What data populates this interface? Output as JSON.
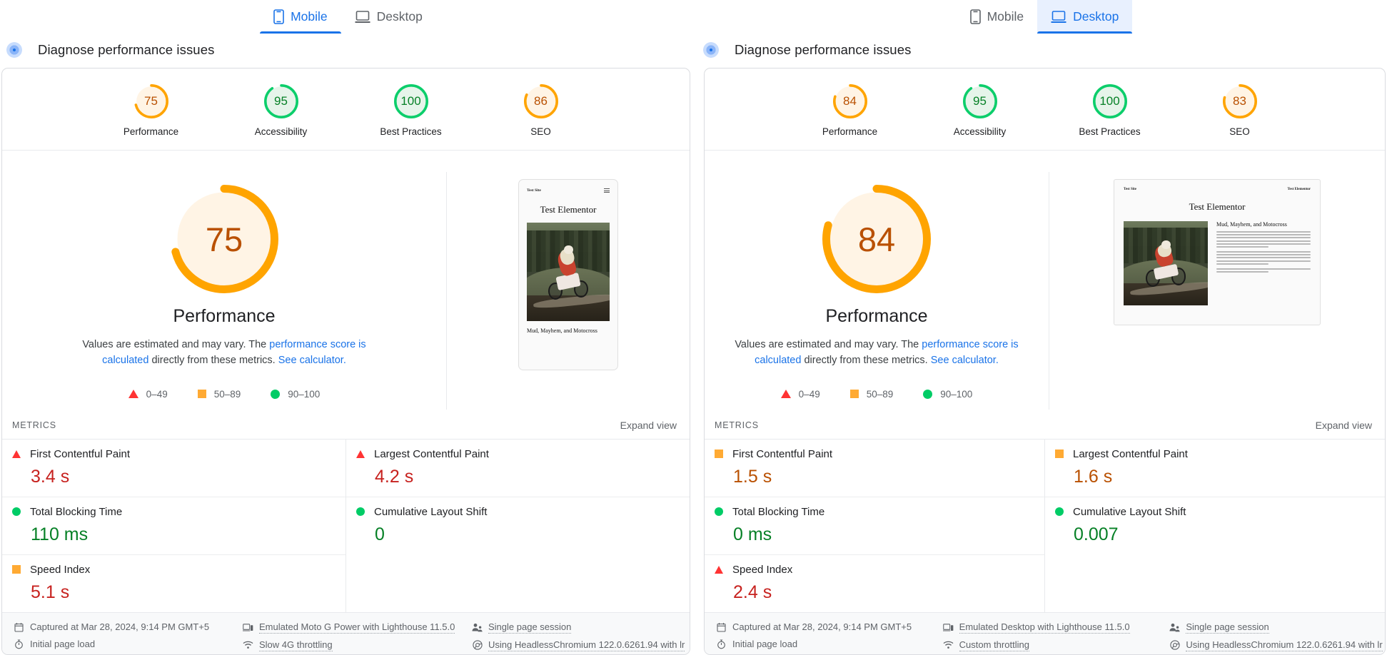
{
  "colors": {
    "orange": "#ffa400",
    "green": "#0cce6b",
    "red": "#ff4e42",
    "orange_text": "#b95000",
    "green_text": "#068026",
    "red_text": "#c7221f",
    "blue": "#1a73e8",
    "gauge_orange_bg": "#fff4e5",
    "gauge_green_bg": "#e6f4ea"
  },
  "panels": [
    {
      "id": "mobile-panel",
      "device_tabs": [
        {
          "label": "Mobile",
          "icon": "phone-icon",
          "active": true
        },
        {
          "label": "Desktop",
          "icon": "laptop-icon",
          "active": false
        }
      ],
      "diagnose_label": "Diagnose performance issues",
      "categories": [
        {
          "label": "Performance",
          "score": 75,
          "color": "orange"
        },
        {
          "label": "Accessibility",
          "score": 95,
          "color": "green"
        },
        {
          "label": "Best Practices",
          "score": 100,
          "color": "green"
        },
        {
          "label": "SEO",
          "score": 86,
          "color": "orange"
        }
      ],
      "performance": {
        "score": 75,
        "color": "orange",
        "title": "Performance",
        "desc_1": "Values are estimated and may vary. The ",
        "desc_link_1": "performance score is calculated",
        "desc_2": " directly from these metrics. ",
        "desc_link_2": "See calculator."
      },
      "legend": [
        {
          "shape": "triangle",
          "label": "0–49"
        },
        {
          "shape": "square",
          "label": "50–89"
        },
        {
          "shape": "circle",
          "label": "90–100"
        }
      ],
      "thumbnail": {
        "type": "phone",
        "site_name": "Test Site",
        "heading": "Test Elementor",
        "caption": "Mud, Mayhem, and Motocross"
      },
      "metrics_label": "METRICS",
      "expand_label": "Expand view",
      "metrics_left": [
        {
          "name": "First Contentful Paint",
          "value": "3.4 s",
          "shape": "triangle",
          "value_color": "red_text"
        },
        {
          "name": "Total Blocking Time",
          "value": "110 ms",
          "shape": "circle",
          "value_color": "green_text"
        },
        {
          "name": "Speed Index",
          "value": "5.1 s",
          "shape": "square",
          "value_color": "red_text"
        }
      ],
      "metrics_right": [
        {
          "name": "Largest Contentful Paint",
          "value": "4.2 s",
          "shape": "triangle",
          "value_color": "red_text"
        },
        {
          "name": "Cumulative Layout Shift",
          "value": "0",
          "shape": "circle",
          "value_color": "green_text"
        }
      ],
      "footer": [
        [
          {
            "icon": "calendar-icon",
            "label": "Captured at Mar 28, 2024, 9:14 PM GMT+5",
            "underline": false
          },
          {
            "icon": "stopwatch-icon",
            "label": "Initial page load",
            "underline": false
          }
        ],
        [
          {
            "icon": "devices-icon",
            "label": "Emulated Moto G Power with Lighthouse 11.5.0",
            "underline": true
          },
          {
            "icon": "wifi-icon",
            "label": "Slow 4G throttling",
            "underline": true
          }
        ],
        [
          {
            "icon": "users-icon",
            "label": "Single page session",
            "underline": true
          },
          {
            "icon": "chrome-icon",
            "label": "Using HeadlessChromium 122.0.6261.94 with lr",
            "underline": true
          }
        ]
      ]
    },
    {
      "id": "desktop-panel",
      "device_tabs": [
        {
          "label": "Mobile",
          "icon": "phone-icon",
          "active": false
        },
        {
          "label": "Desktop",
          "icon": "laptop-icon",
          "active": true
        }
      ],
      "diagnose_label": "Diagnose performance issues",
      "categories": [
        {
          "label": "Performance",
          "score": 84,
          "color": "orange"
        },
        {
          "label": "Accessibility",
          "score": 95,
          "color": "green"
        },
        {
          "label": "Best Practices",
          "score": 100,
          "color": "green"
        },
        {
          "label": "SEO",
          "score": 83,
          "color": "orange"
        }
      ],
      "performance": {
        "score": 84,
        "color": "orange",
        "title": "Performance",
        "desc_1": "Values are estimated and may vary. The ",
        "desc_link_1": "performance score is calculated",
        "desc_2": " directly from these metrics. ",
        "desc_link_2": "See calculator."
      },
      "legend": [
        {
          "shape": "triangle",
          "label": "0–49"
        },
        {
          "shape": "square",
          "label": "50–89"
        },
        {
          "shape": "circle",
          "label": "90–100"
        }
      ],
      "thumbnail": {
        "type": "desktop",
        "site_name": "Test Site",
        "nav_name": "Test Elementor",
        "heading": "Test Elementor",
        "article_heading": "Mud, Mayhem, and Motocross"
      },
      "metrics_label": "METRICS",
      "expand_label": "Expand view",
      "metrics_left": [
        {
          "name": "First Contentful Paint",
          "value": "1.5 s",
          "shape": "square",
          "value_color": "orange_text"
        },
        {
          "name": "Total Blocking Time",
          "value": "0 ms",
          "shape": "circle",
          "value_color": "green_text"
        },
        {
          "name": "Speed Index",
          "value": "2.4 s",
          "shape": "triangle",
          "value_color": "red_text"
        }
      ],
      "metrics_right": [
        {
          "name": "Largest Contentful Paint",
          "value": "1.6 s",
          "shape": "square",
          "value_color": "orange_text"
        },
        {
          "name": "Cumulative Layout Shift",
          "value": "0.007",
          "shape": "circle",
          "value_color": "green_text"
        }
      ],
      "footer": [
        [
          {
            "icon": "calendar-icon",
            "label": "Captured at Mar 28, 2024, 9:14 PM GMT+5",
            "underline": false
          },
          {
            "icon": "stopwatch-icon",
            "label": "Initial page load",
            "underline": false
          }
        ],
        [
          {
            "icon": "devices-icon",
            "label": "Emulated Desktop with Lighthouse 11.5.0",
            "underline": true
          },
          {
            "icon": "wifi-icon",
            "label": "Custom throttling",
            "underline": true
          }
        ],
        [
          {
            "icon": "users-icon",
            "label": "Single page session",
            "underline": true
          },
          {
            "icon": "chrome-icon",
            "label": "Using HeadlessChromium 122.0.6261.94 with lr",
            "underline": true
          }
        ]
      ]
    }
  ]
}
